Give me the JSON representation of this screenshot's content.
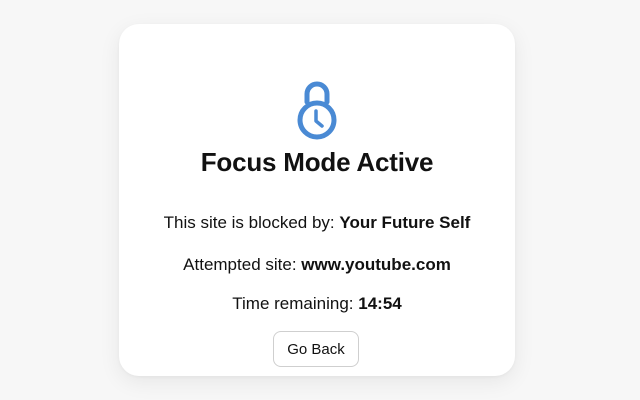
{
  "page": {
    "title": "Focus Mode Active",
    "icon": "lock-clock-icon",
    "accent_color": "#4a8ad4"
  },
  "blocked_by": {
    "label": "This site is blocked by:",
    "value": "Your Future Self"
  },
  "attempted_site": {
    "label": "Attempted site:",
    "value": "www.youtube.com"
  },
  "time_remaining": {
    "label": "Time remaining:",
    "value": "14:54"
  },
  "actions": {
    "go_back_label": "Go Back"
  }
}
